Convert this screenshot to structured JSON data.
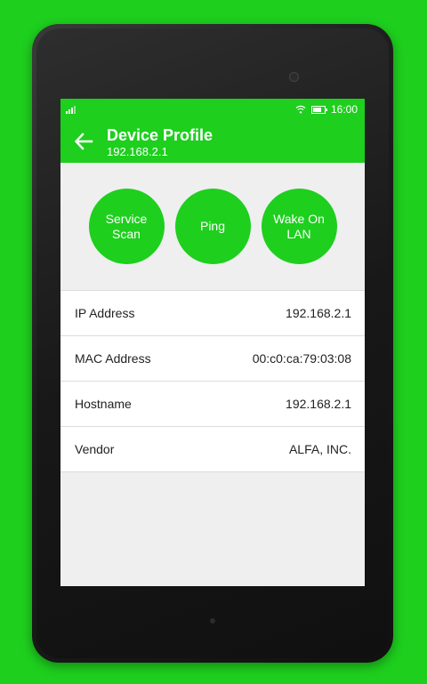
{
  "status_bar": {
    "time": "16:00"
  },
  "toolbar": {
    "title": "Device Profile",
    "subtitle": "192.168.2.1"
  },
  "actions": [
    {
      "label": "Service\nScan"
    },
    {
      "label": "Ping"
    },
    {
      "label": "Wake On\nLAN"
    }
  ],
  "details": [
    {
      "label": "IP Address",
      "value": "192.168.2.1"
    },
    {
      "label": "MAC Address",
      "value": "00:c0:ca:79:03:08"
    },
    {
      "label": "Hostname",
      "value": "192.168.2.1"
    },
    {
      "label": "Vendor",
      "value": "ALFA, INC."
    }
  ],
  "colors": {
    "accent": "#1ecf1e",
    "background": "#efefef"
  },
  "icons": [
    "signal-icon",
    "wifi-icon",
    "battery-icon",
    "back-arrow-icon"
  ]
}
